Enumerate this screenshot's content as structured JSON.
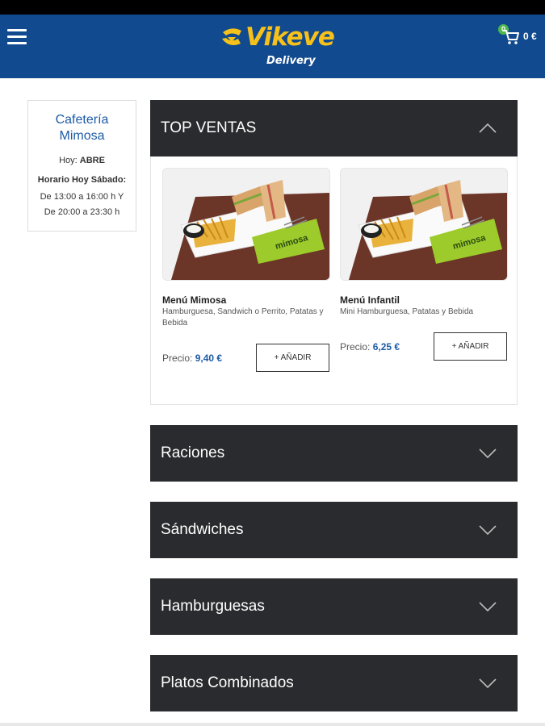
{
  "header": {
    "brand": "Vikeve",
    "brand_sub": "Delivery",
    "cart_count": "0",
    "cart_total": "0 €"
  },
  "restaurant": {
    "name": "Cafetería Mimosa",
    "today_label": "Hoy:",
    "today_status": "ABRE",
    "schedule_title": "Horario Hoy Sábado:",
    "schedule_line1": "De 13:00 a 16:00 h Y",
    "schedule_line2": "De 20:00 a 23:30 h"
  },
  "top_ventas": {
    "title": "TOP VENTAS",
    "products": [
      {
        "name": "Menú Mimosa",
        "description": "Hamburguesa, Sandwich o Perrito, Patatas y Bebida",
        "price_label": "Precio:",
        "price": "9,40 €",
        "add_label": "+ AÑADIR"
      },
      {
        "name": "Menú Infantil",
        "description": "Mini Hamburguesa, Patatas y Bebida",
        "price_label": "Precio:",
        "price": "6,25 €",
        "add_label": "+ AÑADIR"
      }
    ]
  },
  "categories": [
    {
      "title": "Raciones"
    },
    {
      "title": "Sándwiches"
    },
    {
      "title": "Hamburguesas"
    },
    {
      "title": "Platos Combinados"
    }
  ],
  "colors": {
    "header_bg": "#114a8e",
    "brand_yellow": "#f7c11b",
    "dark_panel": "#2a2b2e",
    "link_blue": "#1c5ba6",
    "badge_green": "#4cb84c"
  },
  "icons": {
    "menu": "hamburger-menu-icon",
    "cart": "shopping-cart-icon",
    "collapse": "chevron-up-icon",
    "expand": "chevron-down-icon"
  }
}
